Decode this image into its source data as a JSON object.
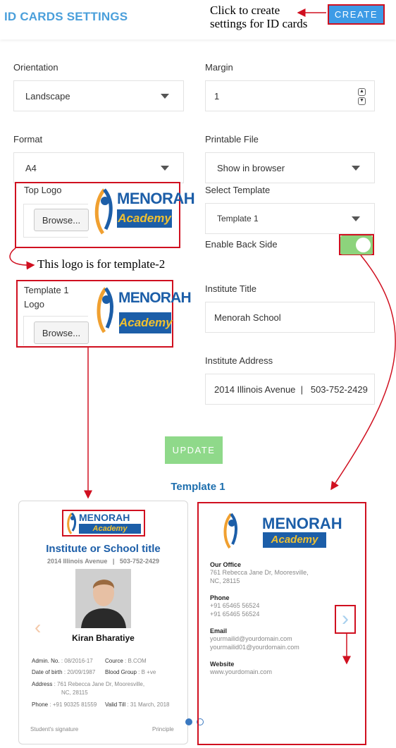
{
  "header": {
    "title": "ID CARDS SETTINGS",
    "create_label": "CREATE",
    "create_callout_line1": "Click to create",
    "create_callout_line2": "settings for ID cards"
  },
  "form": {
    "orientation": {
      "label": "Orientation",
      "value": "Landscape"
    },
    "margin": {
      "label": "Margin",
      "value": "1"
    },
    "format": {
      "label": "Format",
      "value": "A4"
    },
    "printable_file": {
      "label": "Printable File",
      "value": "Show in browser"
    },
    "top_logo": {
      "label": "Top Logo",
      "browse_label": "Browse..."
    },
    "select_template": {
      "label": "Select Template",
      "value": "Template 1"
    },
    "enable_back_side": {
      "label": "Enable Back Side",
      "enabled": true
    },
    "template_logo": {
      "label_line1": "Template 1",
      "label_line2": "Logo",
      "browse_label": "Browse..."
    },
    "institute_title": {
      "label": "Institute Title",
      "value": "Menorah School"
    },
    "institute_address": {
      "label": "Institute Address",
      "value": "2014 Illinois Avenue  |   503-752-2429"
    },
    "logo_callout": "This logo is for template-2",
    "update_label": "UPDATE"
  },
  "logo": {
    "line1": "MENORAH",
    "line2": "Academy"
  },
  "preview": {
    "title": "Template 1",
    "front": {
      "institute_title": "Institute or School title",
      "address": "2014 Illinois Avenue   |   503-752-2429",
      "student_name": "Kiran Bharatiye",
      "admin_no_label": "Admin. No.",
      "admin_no": ": 08/2016-17",
      "course_label": "Cource",
      "course": ": B.COM",
      "dob_label": "Date of birth",
      "dob": ": 20/09/1987",
      "blood_label": "Blood Group",
      "blood": ": B +ve",
      "address_label": "Address",
      "address_line1": ":  761 Rebecca Jane Dr, Mooresville,",
      "address_line2": "NC, 28115",
      "phone_label": "Phone",
      "phone": ": +91 90325 81559",
      "valid_label": "Valid Till",
      "valid": ": 31 March, 2018",
      "signature": "Student's signature",
      "principle": "Principle"
    },
    "back": {
      "office_heading": "Our Office",
      "office_line1": "761 Rebecca Jane Dr, Mooresville,",
      "office_line2": "NC, 28115",
      "phone_heading": "Phone",
      "phone1": "+91 65465 56524",
      "phone2": "+91 65465 56524",
      "email_heading": "Email",
      "email1": "yourmailid@yourdomain.com",
      "email2": "yourmailid01@yourdomain.com",
      "website_heading": "Website",
      "website": "www.yourdomain.com"
    }
  },
  "colors": {
    "accent": "#3d9be6",
    "title_blue": "#4a9fdb",
    "annotation_red": "#d01020",
    "toggle_green": "#8dd37c",
    "update_green": "#8fd98a"
  }
}
